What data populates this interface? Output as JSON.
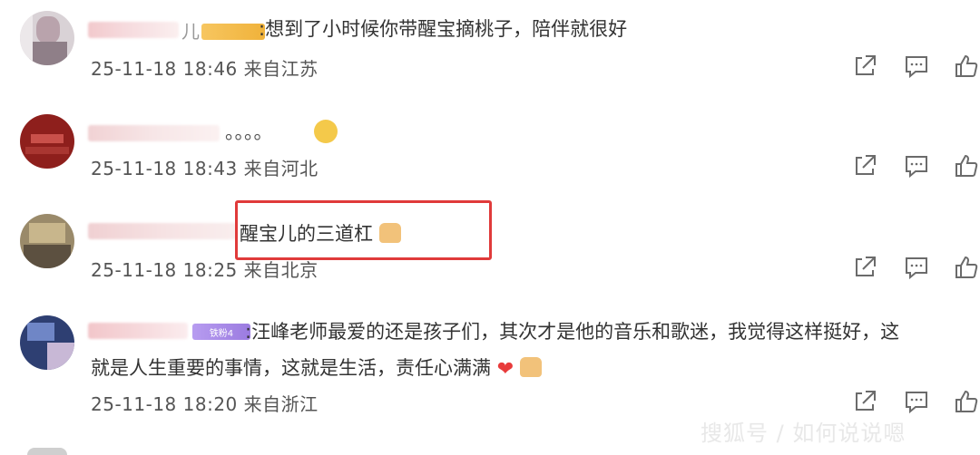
{
  "comments": [
    {
      "name_suffix": "儿",
      "badge": "",
      "text": ":想到了小时候你带醒宝摘桃子，陪伴就很好",
      "timestamp": "25-11-18 18:46",
      "location": "来自江苏"
    },
    {
      "text": "。。。。",
      "timestamp": "25-11-18 18:43",
      "location": "来自河北"
    },
    {
      "text": "醒宝儿的三道杠",
      "timestamp": "25-11-18 18:25",
      "location": "来自北京"
    },
    {
      "badge": "铁粉4",
      "text_line1": ":汪峰老师最爱的还是孩子们，其次才是他的音乐和歌迷，我觉得这样挺好，这",
      "text_line2": "就是人生重要的事情，这就是生活，责任心满满",
      "timestamp": "25-11-18 18:20",
      "location": "来自浙江"
    }
  ],
  "icons": [
    "share-icon",
    "comment-icon",
    "like-icon",
    "thumbs-up-emoji",
    "heart-emoji",
    "smile-emoji"
  ],
  "colors": {
    "highlight_box": "#e03a3a",
    "badge_gold": "#f0b23a",
    "badge_purple": "#9b7be0"
  },
  "watermark": "搜狐号 / 如何说说嗯"
}
